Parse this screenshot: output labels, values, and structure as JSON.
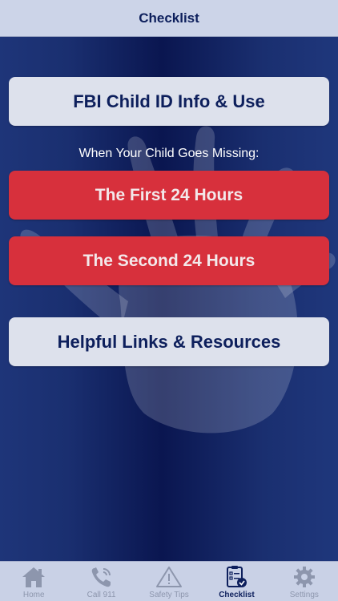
{
  "header": {
    "title": "Checklist"
  },
  "main": {
    "id_button_label": "FBI Child ID Info & Use",
    "section_label": "When Your Child Goes Missing:",
    "first_24_label": "The First 24 Hours",
    "second_24_label": "The Second 24 Hours",
    "links_button_label": "Helpful Links & Resources"
  },
  "tabs": [
    {
      "label": "Home",
      "icon": "home-icon"
    },
    {
      "label": "Call 911",
      "icon": "phone-icon"
    },
    {
      "label": "Safety Tips",
      "icon": "warning-icon"
    },
    {
      "label": "Checklist",
      "icon": "checklist-icon",
      "active": true
    },
    {
      "label": "Settings",
      "icon": "gear-icon"
    }
  ],
  "colors": {
    "nav_bg": "#ccd4e8",
    "brand_navy": "#0d1f5c",
    "button_red": "#d7303c",
    "button_light": "#dde1ec",
    "tab_inactive": "#8d96ad"
  }
}
